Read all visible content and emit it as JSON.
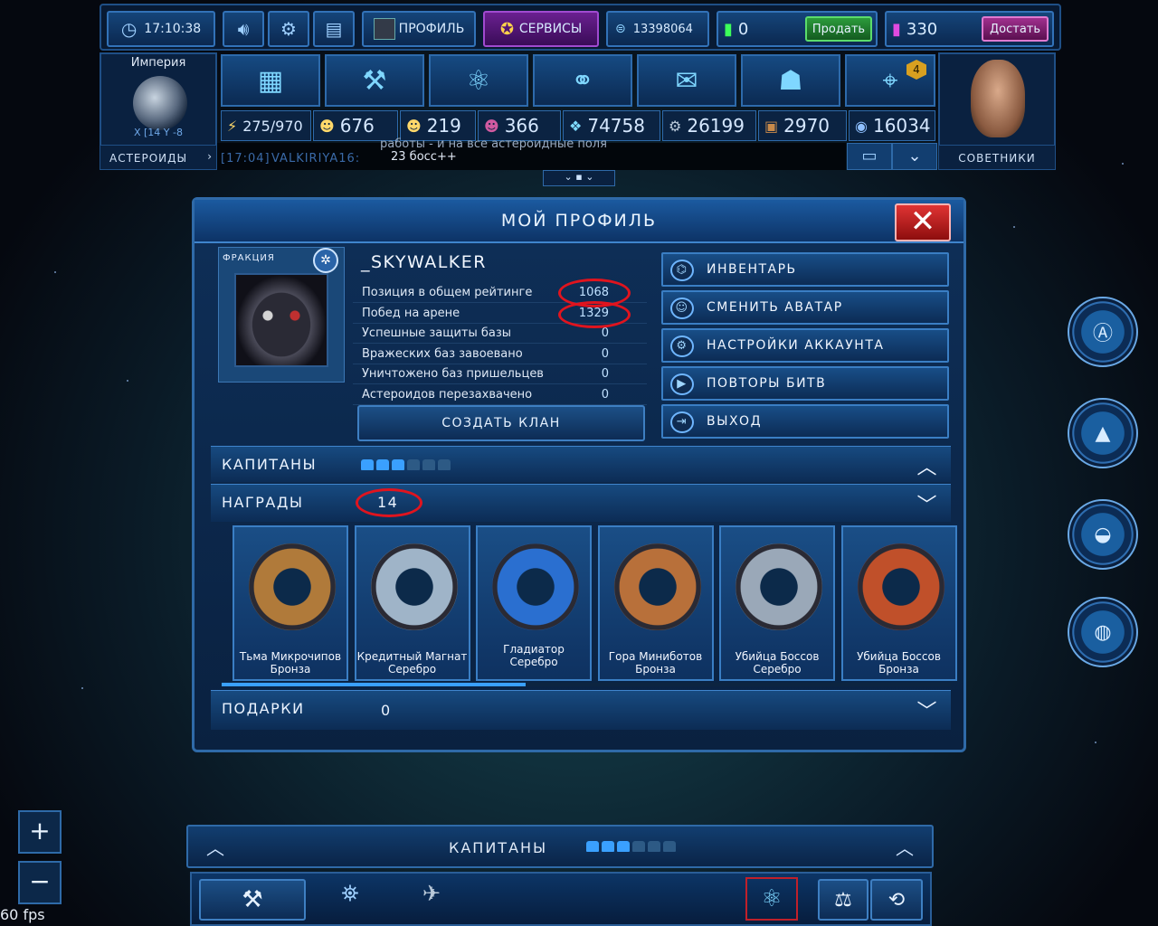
{
  "topbar": {
    "time": "17:10:38",
    "profile_label": "ПРОФИЛЬ",
    "services_label": "СЕРВИСЫ",
    "credits": "13398064",
    "green_value": "0",
    "sell_label": "Продать",
    "purple_value": "330",
    "get_label": "Достать"
  },
  "empire": {
    "title": "Империя",
    "coords": "X [14 Y -8",
    "asteroids_label": "АСТЕРОИДЫ"
  },
  "advisors_label": "СОВЕТНИКИ",
  "nav_badge": "4",
  "resources": {
    "energy": "275/970",
    "r1": "676",
    "r2": "219",
    "r3": "366",
    "crystals": "74758",
    "gears": "26199",
    "crates": "2970",
    "core": "16034"
  },
  "chat": {
    "time": "[17:04]",
    "sender": "VALKIRIYA16:",
    "line1": "работы - и на все астероидные поля",
    "line2": "23 босс++"
  },
  "dialog": {
    "title": "МОЙ ПРОФИЛЬ",
    "faction_label": "ФРАКЦИЯ",
    "username": "_SKYWALKER",
    "stats": [
      {
        "label": "Позиция в общем рейтинге",
        "value": "1068"
      },
      {
        "label": "Побед на арене",
        "value": "1329"
      },
      {
        "label": "Успешные защиты базы",
        "value": "0"
      },
      {
        "label": "Вражеских баз завоевано",
        "value": "0"
      },
      {
        "label": "Уничтожено баз пришельцев",
        "value": "0"
      },
      {
        "label": "Астероидов перезахвачено",
        "value": "0"
      }
    ],
    "create_clan": "СОЗДАТЬ КЛАН",
    "buttons": {
      "inventory": "ИНВЕНТАРЬ",
      "change_avatar": "СМЕНИТЬ АВАТАР",
      "account_settings": "НАСТРОЙКИ АККАУНТА",
      "battle_replays": "ПОВТОРЫ БИТВ",
      "exit": "ВЫХОД"
    },
    "captains_label": "КАПИТАНЫ",
    "awards_label": "НАГРАДЫ",
    "awards_count": "14",
    "gifts_label": "ПОДАРКИ",
    "gifts_count": "0",
    "awards": [
      {
        "line1": "Тьма Микрочипов",
        "line2": "Бронза",
        "color": "#b07a3a"
      },
      {
        "line1": "Кредитный Магнат",
        "line2": "Серебро",
        "color": "#9fb4c8"
      },
      {
        "line1": "Гладиатор Серебро",
        "line2": "",
        "color": "#2a6fd0"
      },
      {
        "line1": "Гора Миниботов",
        "line2": "Бронза",
        "color": "#b8703a"
      },
      {
        "line1": "Убийца Боссов",
        "line2": "Серебро",
        "color": "#9aa8b8"
      },
      {
        "line1": "Убийца Боссов",
        "line2": "Бронза",
        "color": "#c0502a"
      }
    ]
  },
  "bottom": {
    "captains_label": "КАПИТАНЫ"
  },
  "fps": "60 fps"
}
